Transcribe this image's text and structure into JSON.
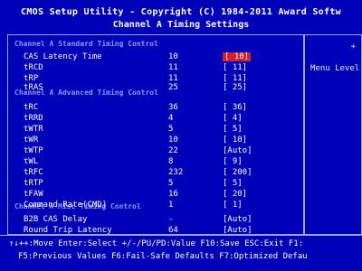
{
  "header": {
    "title": "CMOS Setup Utility - Copyright (C) 1984-2011 Award Softw",
    "subtitle": "Channel A Timing Settings"
  },
  "groups": {
    "g1": "Channel A Standard Timing Control",
    "g2": "Channel A Advanced Timing Control",
    "g3": "Channel A Misc Timing Control"
  },
  "rows": [
    {
      "label": "CAS Latency Time",
      "auto": "10",
      "val": "[  10]"
    },
    {
      "label": "tRCD",
      "auto": "11",
      "val": "[  11]"
    },
    {
      "label": "tRP",
      "auto": "11",
      "val": "[  11]"
    },
    {
      "label": "tRAS",
      "auto": "25",
      "val": "[  25]"
    },
    {
      "label": "tRC",
      "auto": "36",
      "val": "[  36]"
    },
    {
      "label": "tRRD",
      "auto": "4",
      "val": "[   4]"
    },
    {
      "label": "tWTR",
      "auto": "5",
      "val": "[   5]"
    },
    {
      "label": "tWR",
      "auto": "10",
      "val": "[  10]"
    },
    {
      "label": "tWTP",
      "auto": "22",
      "val": "[Auto]"
    },
    {
      "label": "tWL",
      "auto": "8",
      "val": "[   9]"
    },
    {
      "label": "tRFC",
      "auto": "232",
      "val": "[ 200]"
    },
    {
      "label": "tRTP",
      "auto": "5",
      "val": "[   5]"
    },
    {
      "label": "tFAW",
      "auto": "16",
      "val": "[  20]"
    },
    {
      "label": "Command Rate(CMD)",
      "auto": "1",
      "val": "[   1]"
    },
    {
      "label": "B2B CAS Delay",
      "auto": "-",
      "val": "[Auto]"
    },
    {
      "label": "Round Trip Latency",
      "auto": "64",
      "val": "[Auto]"
    }
  ],
  "side": {
    "help": "Menu Level"
  },
  "footer": {
    "line1": "↑↓++:Move  Enter:Select  +/-/PU/PD:Value  F10:Save  ESC:Exit  F1:",
    "line2": "F5:Previous Values  F6:Fail-Safe Defaults  F7:Optimized Defau"
  }
}
